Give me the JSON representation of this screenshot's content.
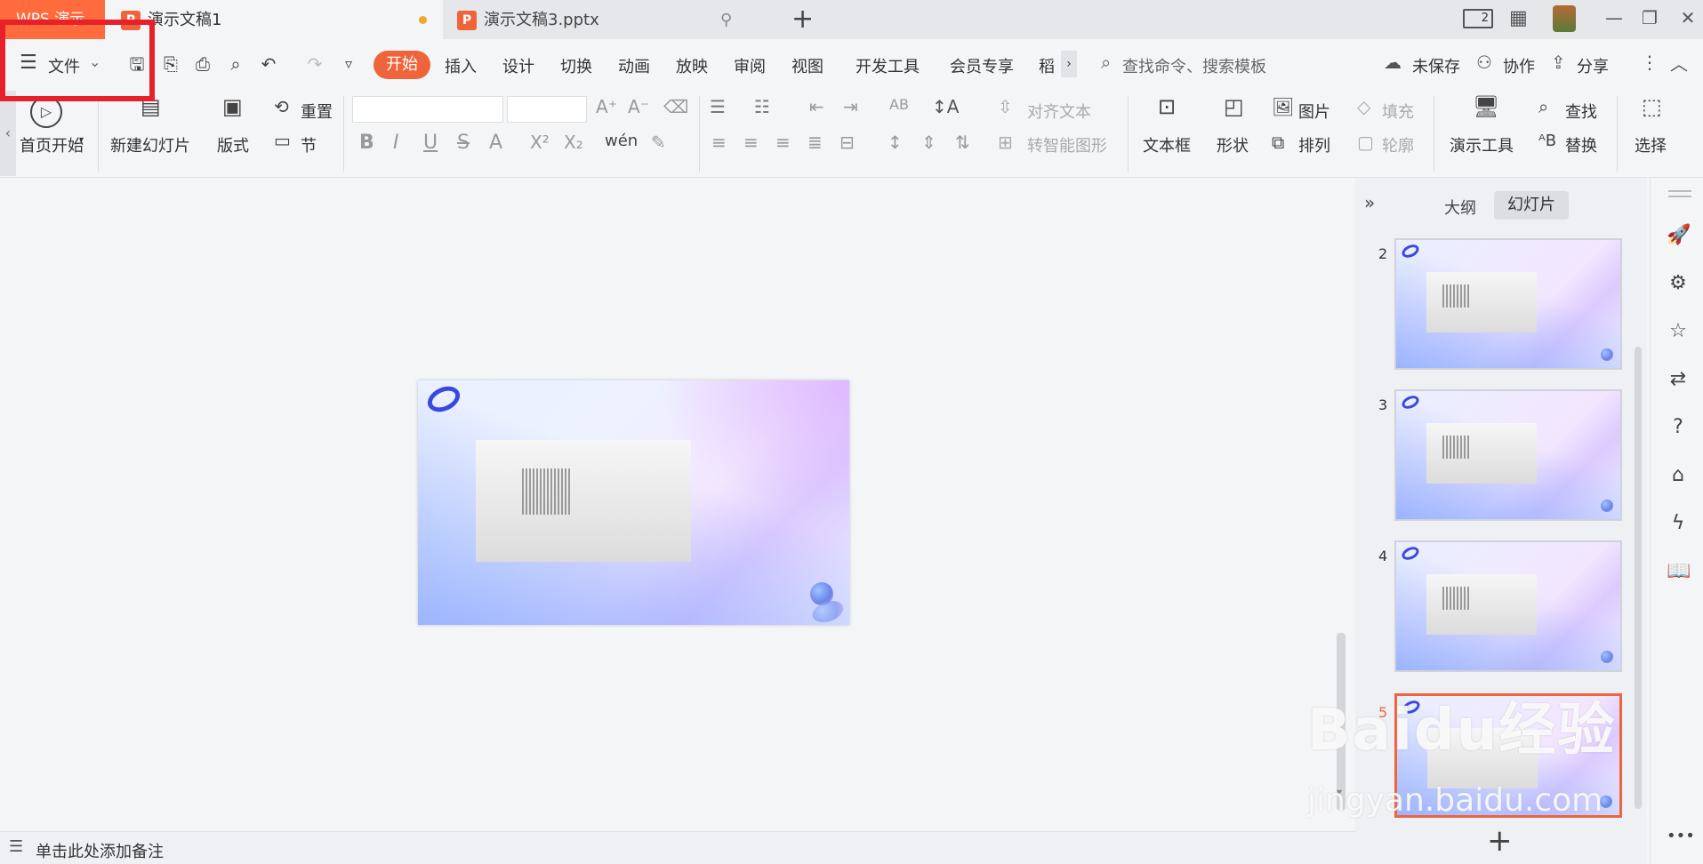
{
  "titlebar": {
    "app_tab": "WPS 演示",
    "active_tab": "演示文稿1",
    "inactive_tab": "演示文稿3.pptx",
    "add_tab": "+",
    "page_indicator": "2"
  },
  "menubar": {
    "file": "文件",
    "tabs": [
      "开始",
      "插入",
      "设计",
      "切换",
      "动画",
      "放映",
      "审阅",
      "视图",
      "开发工具",
      "会员专享",
      "稻"
    ],
    "search_placeholder": "查找命令、搜索模板",
    "unsaved": "未保存",
    "collab": "协作",
    "share": "分享"
  },
  "ribbon": {
    "play_from_start": "首页开始",
    "new_slide": "新建幻灯片",
    "layout": "版式",
    "reset": "重置",
    "section": "节",
    "align_text": "对齐文本",
    "smart_shape": "转智能图形",
    "textbox": "文本框",
    "shape": "形状",
    "picture": "图片",
    "arrange": "排列",
    "fill": "填充",
    "outline": "轮廓",
    "present_tools": "演示工具",
    "find": "查找",
    "replace": "替换",
    "select": "选择"
  },
  "panel": {
    "outline_tab": "大纲",
    "slides_tab": "幻灯片",
    "slide_numbers": [
      "2",
      "3",
      "4",
      "5"
    ],
    "selected_slide": "5",
    "add": "+"
  },
  "statusbar": {
    "notes": "单击此处添加备注"
  },
  "watermark": {
    "line1": "Baidu经验",
    "line2": "jingyan.baidu.com"
  },
  "colors": {
    "accent": "#f0643c",
    "highlight_box": "#e8202a"
  }
}
